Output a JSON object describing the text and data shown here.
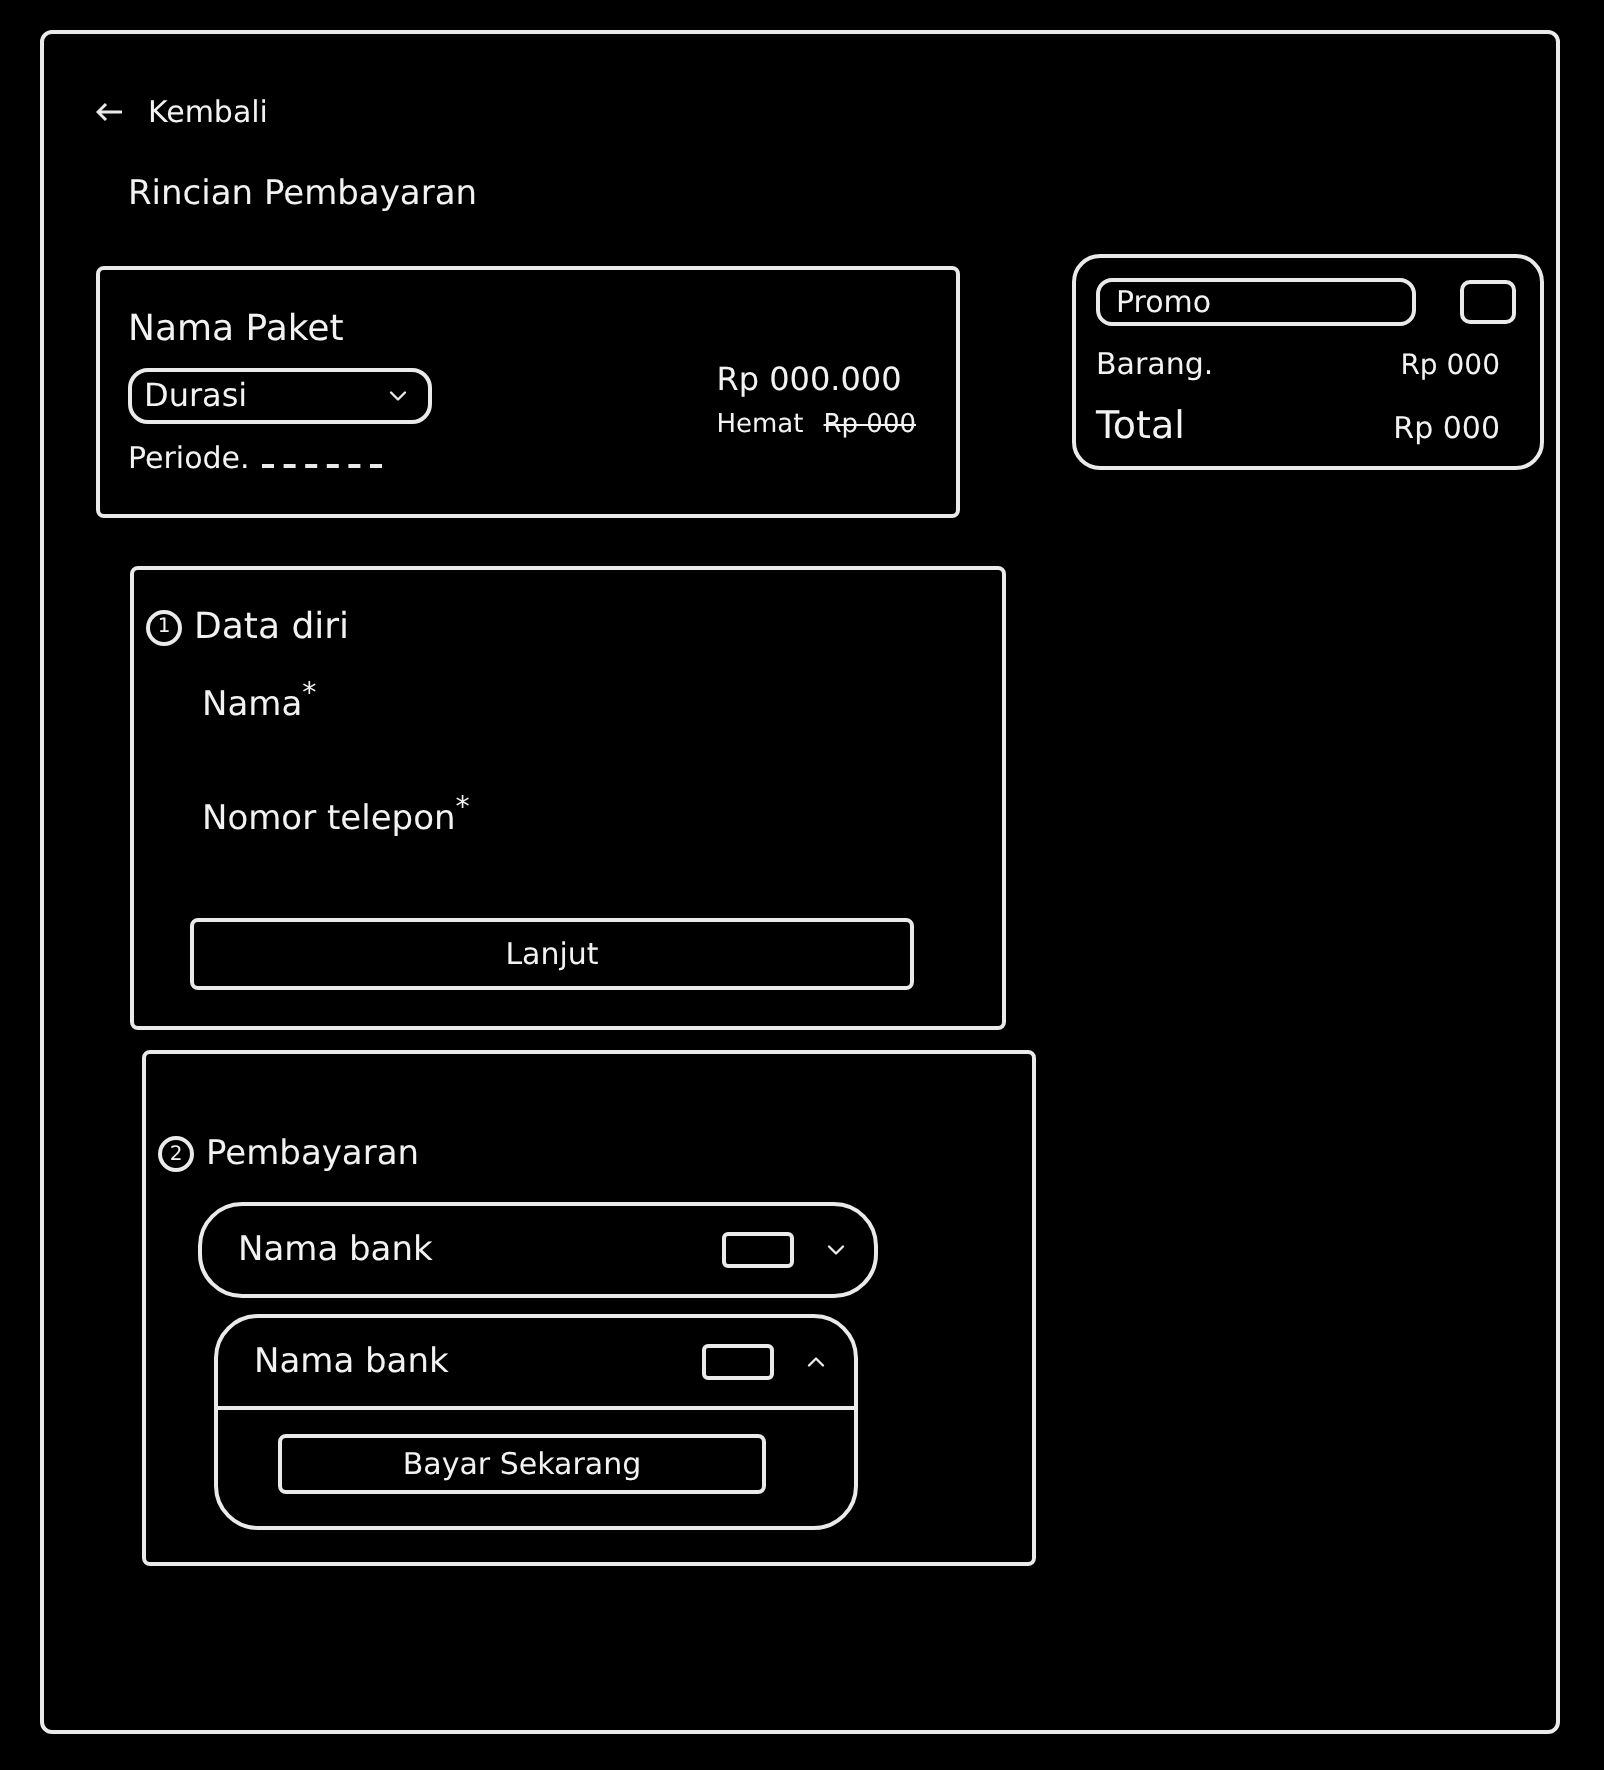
{
  "header": {
    "back_label": "Kembali",
    "title": "Rincian Pembayaran"
  },
  "package": {
    "name": "Nama Paket",
    "duration": "Durasi",
    "period_label": "Periode.",
    "price": "Rp 000.000",
    "savings_label": "Hemat",
    "savings_amount": "Rp 000"
  },
  "summary": {
    "promo_placeholder": "Promo",
    "rows": [
      {
        "kind": "item",
        "label": "Barang.",
        "value": "Rp 000"
      },
      {
        "kind": "total",
        "label": "Total",
        "value": "Rp 000"
      }
    ]
  },
  "steps": [
    {
      "kind": "form",
      "number": "1",
      "title": "Data diri",
      "fields": [
        "Nama$^{*}$",
        "Nomor telepon$^{*}$"
      ],
      "button": "Lanjut"
    },
    {
      "kind": "payment",
      "number": "2",
      "title": "Pembayaran",
      "banks": [
        {
          "name": "Nama bank",
          "expanded": false
        },
        {
          "name": "Nama bank",
          "expanded": true,
          "button": "Bayar Sekarang"
        }
      ]
    }
  ]
}
